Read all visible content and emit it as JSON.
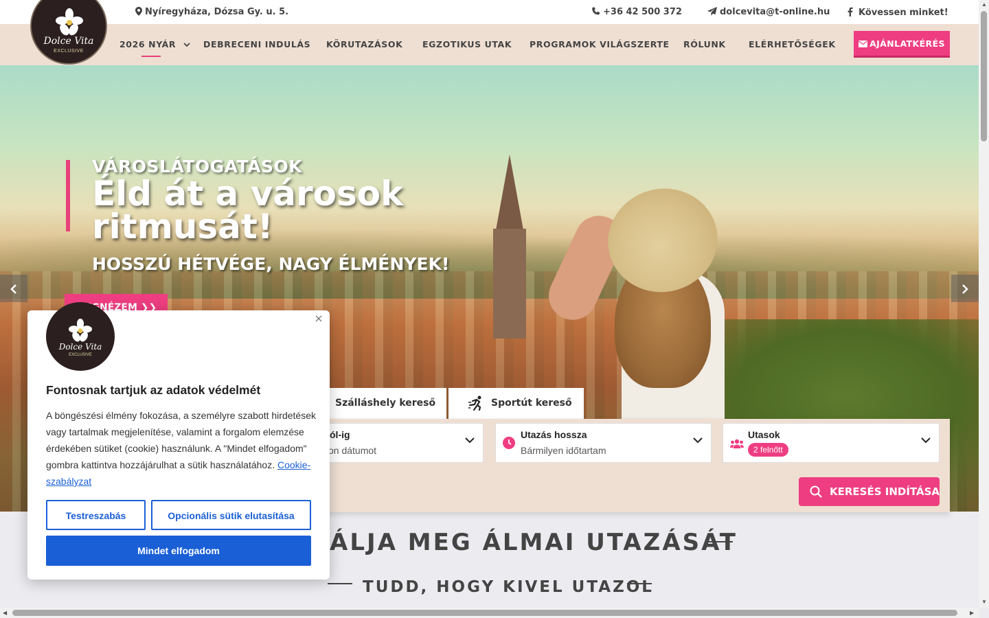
{
  "topbar": {
    "address": "Nyíregyháza, Dózsa Gy. u. 5.",
    "phone": "+36 42 500 372",
    "email": "dolcevita@t-online.hu",
    "social": "Kövessen minket!"
  },
  "logo": {
    "brand": "Dolce Vita",
    "sub": "EXCLUSIVE"
  },
  "nav": {
    "items": [
      "2026 NYÁR",
      "DEBRECENI INDULÁS",
      "KÖRUTAZÁSOK",
      "EGZOTIKUS UTAK",
      "PROGRAMOK VILÁGSZERTE",
      "RÓLUNK",
      "ELÉRHETŐSÉGEK"
    ],
    "offer_button": "AJÁNLATKÉRÉS"
  },
  "hero": {
    "kicker": "VÁROSLÁTOGATÁSOK",
    "title": "Éld át a városok ritmusát!",
    "subtitle": "HOSSZÚ HÉTVÉGE, NAGY ÉLMÉNYEK!",
    "button": "MEGNÉZEM ❯❯"
  },
  "search": {
    "tabs": [
      "Szálláshely kereső",
      "Sportút kereső"
    ],
    "fields": [
      {
        "label": "ól-ig",
        "value": "on dátumot"
      },
      {
        "label": "Utazás hossza",
        "value": "Bármilyen időtartam"
      },
      {
        "label": "Utasok",
        "value": "2 felnőtt"
      }
    ],
    "button": "KERESÉS INDÍTÁSA"
  },
  "sections": {
    "dream": "ÁLJA MEG ÁLMAI UTAZÁSÁT",
    "who": "TUDD, HOGY KIVEL UTAZOL"
  },
  "cookie": {
    "title": "Fontosnak tartjuk az adatok védelmét",
    "text": "A böngészési élmény fokozása, a személyre szabott hirdetések vagy tartalmak megjelenítése, valamint a forgalom elemzése érdekében sütiket (cookie) használunk. A \"Mindet elfogadom\" gombra kattintva hozzájárulhat a sütik használatához.",
    "policy_link": "Cookie-szabályzat",
    "customize": "Testreszabás",
    "reject": "Opcionális sütik elutasítása",
    "accept": "Mindet elfogadom"
  },
  "colors": {
    "accent": "#ee3e81",
    "nav_bg": "#efdfd3",
    "cookie_blue": "#1a5fd6"
  }
}
